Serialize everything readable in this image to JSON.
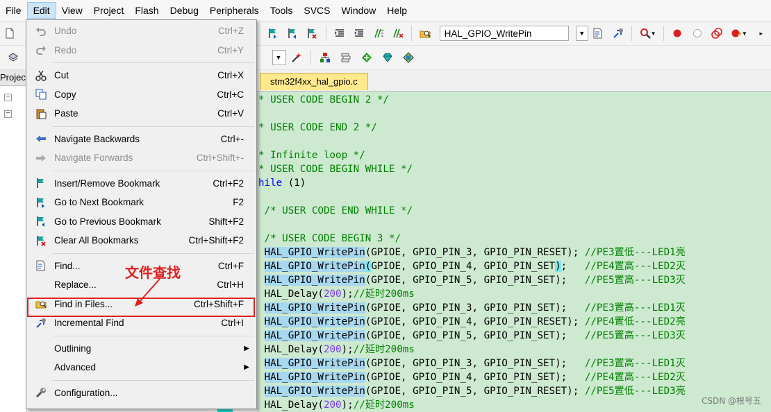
{
  "menubar": [
    "File",
    "Edit",
    "View",
    "Project",
    "Flash",
    "Debug",
    "Peripherals",
    "Tools",
    "SVCS",
    "Window",
    "Help"
  ],
  "toolbar": {
    "function_combo": "HAL_GPIO_WritePin"
  },
  "project_pane": {
    "tab_label": "Project"
  },
  "editor": {
    "tab": "stm32f4xx_hal_gpio.c",
    "lines": [
      {
        "parts": [
          [
            "* USER CODE BEGIN 2 */",
            "cmt"
          ]
        ]
      },
      {
        "parts": []
      },
      {
        "parts": [
          [
            "* USER CODE END 2 */",
            "cmt"
          ]
        ]
      },
      {
        "parts": []
      },
      {
        "parts": [
          [
            "* Infinite loop */",
            "cmt"
          ]
        ]
      },
      {
        "parts": [
          [
            "* USER CODE BEGIN WHILE */",
            "cmt"
          ]
        ]
      },
      {
        "parts": [
          [
            "hile",
            "kw"
          ],
          [
            " (1)",
            ""
          ]
        ]
      },
      {
        "parts": []
      },
      {
        "parts": [
          [
            " /* USER CODE END WHILE */",
            "cmt"
          ]
        ]
      },
      {
        "parts": []
      },
      {
        "parts": [
          [
            " /* USER CODE BEGIN 3 */",
            "cmt"
          ]
        ]
      },
      {
        "parts": [
          [
            " ",
            ""
          ],
          [
            "HAL_GPIO_WritePin",
            "sel"
          ],
          [
            "(GPIOE, GPIO_PIN_3, GPIO_PIN_RESET); ",
            ""
          ],
          [
            "//PE3置低---LED1亮",
            "cmt"
          ]
        ]
      },
      {
        "parts": [
          [
            " ",
            ""
          ],
          [
            "HAL_GPIO_WritePin",
            "sel"
          ],
          [
            "(",
            "cyan"
          ],
          [
            "GPIOE, GPIO_PIN_4, GPIO_PIN_SET",
            ""
          ],
          [
            ")",
            "cyan"
          ],
          [
            ";   ",
            ""
          ],
          [
            "//PE4置高---LED2灭",
            "cmt"
          ]
        ]
      },
      {
        "parts": [
          [
            " ",
            ""
          ],
          [
            "HAL_GPIO_WritePin",
            "sel"
          ],
          [
            "(GPIOE, GPIO_PIN_5, GPIO_PIN_SET);   ",
            ""
          ],
          [
            "//PE5置高---LED3灭",
            "cmt"
          ]
        ]
      },
      {
        "parts": [
          [
            " HAL_Delay(",
            ""
          ],
          [
            "200",
            "num"
          ],
          [
            ");",
            ""
          ],
          [
            "//延时200ms",
            "cmt"
          ]
        ]
      },
      {
        "parts": [
          [
            " ",
            ""
          ],
          [
            "HAL_GPIO_WritePin",
            "sel"
          ],
          [
            "(GPIOE, GPIO_PIN_3, GPIO_PIN_SET);   ",
            ""
          ],
          [
            "//PE3置高---LED1灭",
            "cmt"
          ]
        ]
      },
      {
        "parts": [
          [
            " ",
            ""
          ],
          [
            "HAL_GPIO_WritePin",
            "sel"
          ],
          [
            "(GPIOE, GPIO_PIN_4, GPIO_PIN_RESET); ",
            ""
          ],
          [
            "//PE4置低---LED2亮",
            "cmt"
          ]
        ]
      },
      {
        "parts": [
          [
            " ",
            ""
          ],
          [
            "HAL_GPIO_WritePin",
            "sel"
          ],
          [
            "(GPIOE, GPIO_PIN_5, GPIO_PIN_SET);   ",
            ""
          ],
          [
            "//PE5置高---LED3灭",
            "cmt"
          ]
        ]
      },
      {
        "parts": [
          [
            " HAL_Delay(",
            ""
          ],
          [
            "200",
            "num"
          ],
          [
            ");",
            ""
          ],
          [
            "//延时200ms",
            "cmt"
          ]
        ]
      },
      {
        "parts": [
          [
            " ",
            ""
          ],
          [
            "HAL_GPIO_WritePin",
            "sel"
          ],
          [
            "(GPIOE, GPIO_PIN_3, GPIO_PIN_SET);   ",
            ""
          ],
          [
            "//PE3置高---LED1灭",
            "cmt"
          ]
        ]
      },
      {
        "parts": [
          [
            " ",
            ""
          ],
          [
            "HAL_GPIO_WritePin",
            "sel"
          ],
          [
            "(GPIOE, GPIO_PIN_4, GPIO_PIN_SET);   ",
            ""
          ],
          [
            "//PE4置高---LED2灭",
            "cmt"
          ]
        ]
      },
      {
        "parts": [
          [
            " ",
            ""
          ],
          [
            "HAL_GPIO_WritePin",
            "sel"
          ],
          [
            "(GPIOE, GPIO_PIN_5, GPIO_PIN_RESET); ",
            ""
          ],
          [
            "//PE5置低---LED3亮",
            "cmt"
          ]
        ]
      },
      {
        "parts": [
          [
            " HAL_Delay(",
            ""
          ],
          [
            "200",
            "num"
          ],
          [
            ");",
            ""
          ],
          [
            "//延时200ms",
            "cmt"
          ]
        ]
      }
    ]
  },
  "edit_menu": [
    {
      "label": "Undo",
      "shortcut": "Ctrl+Z",
      "icon": "undo-icon",
      "disabled": true
    },
    {
      "label": "Redo",
      "shortcut": "Ctrl+Y",
      "icon": "redo-icon",
      "disabled": true
    },
    {
      "sep": true
    },
    {
      "label": "Cut",
      "shortcut": "Ctrl+X",
      "icon": "scissors-icon"
    },
    {
      "label": "Copy",
      "shortcut": "Ctrl+C",
      "icon": "copy-icon"
    },
    {
      "label": "Paste",
      "shortcut": "Ctrl+V",
      "icon": "paste-icon"
    },
    {
      "sep": true
    },
    {
      "label": "Navigate Backwards",
      "shortcut": "Ctrl+-",
      "icon": "arrow-left-icon"
    },
    {
      "label": "Navigate Forwards",
      "shortcut": "Ctrl+Shift+-",
      "icon": "arrow-right-icon",
      "disabled": true
    },
    {
      "sep": true
    },
    {
      "label": "Insert/Remove Bookmark",
      "shortcut": "Ctrl+F2",
      "icon": "bookmark-flag-icon"
    },
    {
      "label": "Go to Next Bookmark",
      "shortcut": "F2",
      "icon": "next-bookmark-icon"
    },
    {
      "label": "Go to Previous Bookmark",
      "shortcut": "Shift+F2",
      "icon": "previous-bookmark-icon"
    },
    {
      "label": "Clear All Bookmarks",
      "shortcut": "Ctrl+Shift+F2",
      "icon": "clear-bookmarks-icon"
    },
    {
      "sep": true
    },
    {
      "label": "Find...",
      "shortcut": "Ctrl+F",
      "icon": "find-icon"
    },
    {
      "label": "Replace...",
      "shortcut": "Ctrl+H",
      "icon": ""
    },
    {
      "label": "Find in Files...",
      "shortcut": "Ctrl+Shift+F",
      "icon": "find-in-files-icon",
      "boxed": true
    },
    {
      "label": "Incremental Find",
      "shortcut": "Ctrl+I",
      "icon": "incremental-find-icon"
    },
    {
      "sep": true
    },
    {
      "label": "Outlining",
      "shortcut": "",
      "icon": "",
      "submenu": true
    },
    {
      "label": "Advanced",
      "shortcut": "",
      "icon": "",
      "submenu": true
    },
    {
      "sep": true
    },
    {
      "label": "Configuration...",
      "shortcut": "",
      "icon": "wrench-icon"
    }
  ],
  "annotation": "文件查找",
  "watermark": "CSDN @根号五"
}
